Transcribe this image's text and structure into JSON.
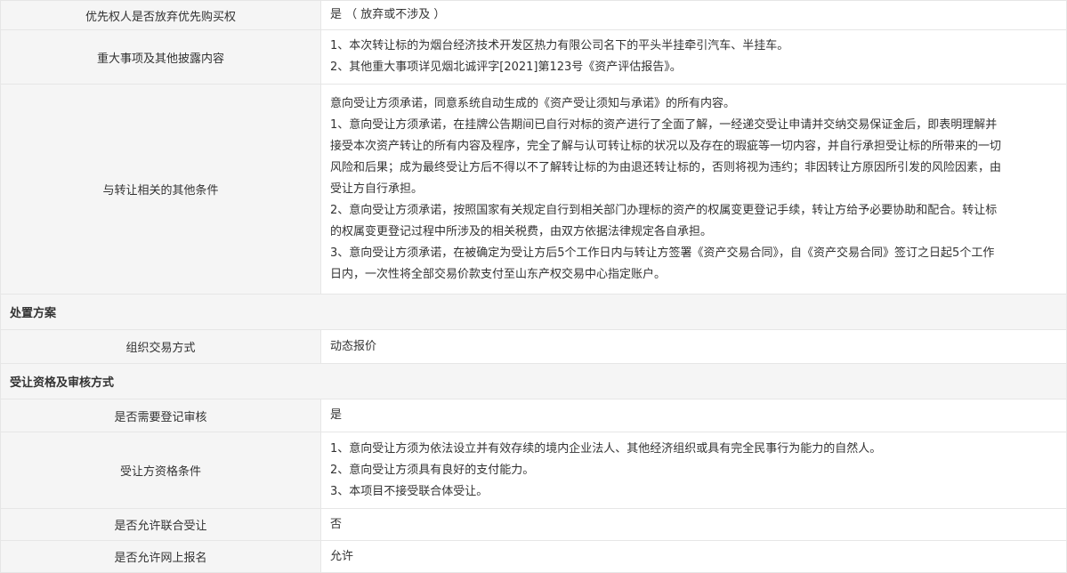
{
  "rows_top": [
    {
      "label": "优先权人是否放弃优先购买权",
      "lines": [
        "是 （ 放弃或不涉及 ）"
      ]
    },
    {
      "label": "重大事项及其他披露内容",
      "lines": [
        "1、本次转让标的为烟台经济技术开发区热力有限公司名下的平头半挂牵引汽车、半挂车。",
        "2、其他重大事项详见烟北诚评字[2021]第123号《资产评估报告》。"
      ]
    },
    {
      "label": "与转让相关的其他条件",
      "lines": [
        "意向受让方须承诺，同意系统自动生成的《资产受让须知与承诺》的所有内容。",
        "1、意向受让方须承诺，在挂牌公告期间已自行对标的资产进行了全面了解，一经递交受让申请并交纳交易保证金后，即表明理解并",
        "接受本次资产转让的所有内容及程序，完全了解与认可转让标的状况以及存在的瑕疵等一切内容，并自行承担受让标的所带来的一切",
        "风险和后果；成为最终受让方后不得以不了解转让标的为由退还转让标的，否则将视为违约；非因转让方原因所引发的风险因素，由",
        "受让方自行承担。",
        "2、意向受让方须承诺，按照国家有关规定自行到相关部门办理标的资产的权属变更登记手续，转让方给予必要协助和配合。转让标",
        "的权属变更登记过程中所涉及的相关税费，由双方依据法律规定各自承担。",
        "3、意向受让方须承诺，在被确定为受让方后5个工作日内与转让方签署《资产交易合同》，自《资产交易合同》签订之日起5个工作",
        "日内，一次性将全部交易价款支付至山东产权交易中心指定账户。"
      ]
    }
  ],
  "section_disposal": {
    "title": "处置方案",
    "rows": [
      {
        "label": "组织交易方式",
        "lines": [
          "动态报价"
        ]
      }
    ]
  },
  "section_qualification": {
    "title": "受让资格及审核方式",
    "rows": [
      {
        "label": "是否需要登记审核",
        "lines": [
          "是"
        ]
      },
      {
        "label": "受让方资格条件",
        "lines": [
          "1、意向受让方须为依法设立并有效存续的境内企业法人、其他经济组织或具有完全民事行为能力的自然人。",
          "2、意向受让方须具有良好的支付能力。",
          "3、本项目不接受联合体受让。"
        ]
      },
      {
        "label": "是否允许联合受让",
        "lines": [
          "否"
        ]
      },
      {
        "label": "是否允许网上报名",
        "lines": [
          "允许"
        ]
      }
    ]
  }
}
